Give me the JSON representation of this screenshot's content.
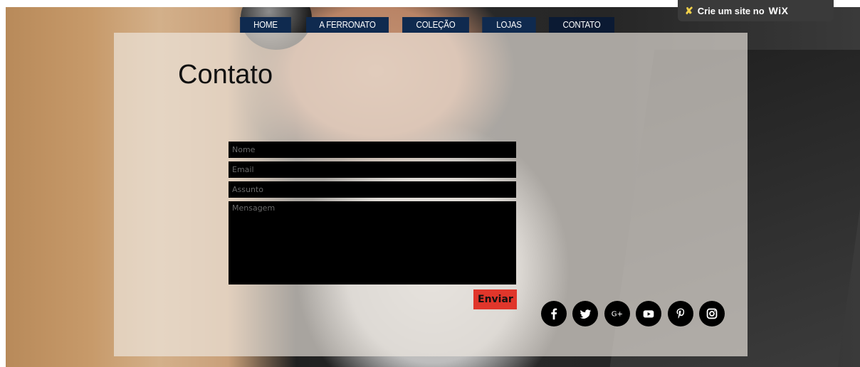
{
  "nav": {
    "items": [
      {
        "label": "HOME"
      },
      {
        "label": "A FERRONATO"
      },
      {
        "label": "COLEÇÃO"
      },
      {
        "label": "LOJAS"
      },
      {
        "label": "CONTATO"
      }
    ]
  },
  "wix": {
    "text": "Crie um site no",
    "brand": "WiX"
  },
  "page": {
    "title": "Contato"
  },
  "form": {
    "name_placeholder": "Nome",
    "email_placeholder": "Email",
    "subject_placeholder": "Assunto",
    "message_placeholder": "Mensagem",
    "send_label": "Enviar"
  },
  "social": [
    "facebook-icon",
    "twitter-icon",
    "google-plus-icon",
    "youtube-icon",
    "pinterest-icon",
    "instagram-icon"
  ],
  "colors": {
    "nav_bg": "#0f2a4f",
    "send_bg": "#e0362b"
  }
}
